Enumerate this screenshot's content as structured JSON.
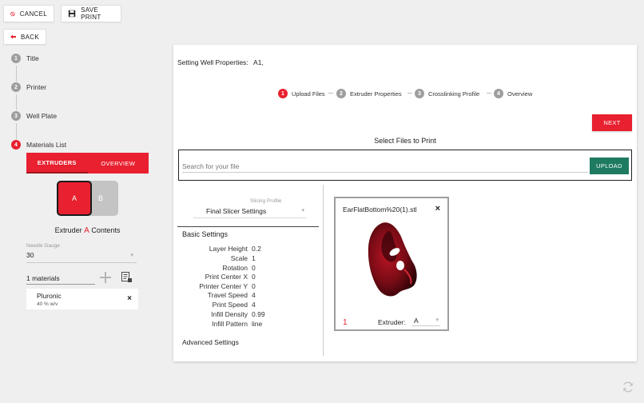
{
  "toolbar": {
    "cancel_label": "CANCEL",
    "save_label": "SAVE PRINT",
    "back_label": "BACK"
  },
  "steps": [
    {
      "num": "1",
      "label": "Title"
    },
    {
      "num": "2",
      "label": "Printer"
    },
    {
      "num": "3",
      "label": "Well Plate"
    },
    {
      "num": "4",
      "label": "Materials List"
    }
  ],
  "tabs": {
    "extruders": "EXTRUDERS",
    "overview": "OVERVIEW"
  },
  "extruders": {
    "a": "A",
    "b": "B"
  },
  "contents": {
    "prefix": "Extruder",
    "letter": "A",
    "suffix": "Contents"
  },
  "needle": {
    "label": "Needle Gauge",
    "value": "30"
  },
  "materials": {
    "count": "1 materials",
    "item_name": "Pluronic",
    "item_detail": "40 % w/v"
  },
  "well": {
    "title": "Setting Well Properties:",
    "value": "A1,"
  },
  "wizard": [
    {
      "num": "1",
      "label": "Upload Files"
    },
    {
      "num": "2",
      "label": "Extruder Properties"
    },
    {
      "num": "3",
      "label": "Crosslinking Profile"
    },
    {
      "num": "4",
      "label": "Overview"
    }
  ],
  "next_label": "NEXT",
  "select_title": "Select Files to Print",
  "search": {
    "placeholder": "Search for your file",
    "upload": "UPLOAD"
  },
  "slicer": {
    "label": "Slicing Profile",
    "value": "Final Slicer Settings"
  },
  "basic": {
    "title": "Basic Settings",
    "rows": [
      {
        "k": "Layer Height",
        "v": "0.2"
      },
      {
        "k": "Scale",
        "v": "1"
      },
      {
        "k": "Rotation",
        "v": "0"
      },
      {
        "k": "Print Center X",
        "v": "0"
      },
      {
        "k": "Printer Center Y",
        "v": "0"
      },
      {
        "k": "Travel Speed",
        "v": "4"
      },
      {
        "k": "Print Speed",
        "v": "4"
      },
      {
        "k": "Infill Density",
        "v": "0.99"
      },
      {
        "k": "Infill Pattern",
        "v": "line"
      }
    ]
  },
  "advanced_title": "Advanced Settings",
  "file": {
    "name": "EarFlatBottom%20(1).stl",
    "index": "1",
    "extruder_label": "Extruder:",
    "extruder_value": "A"
  },
  "colors": {
    "accent": "#e8202f",
    "upload": "#1e7b62"
  }
}
